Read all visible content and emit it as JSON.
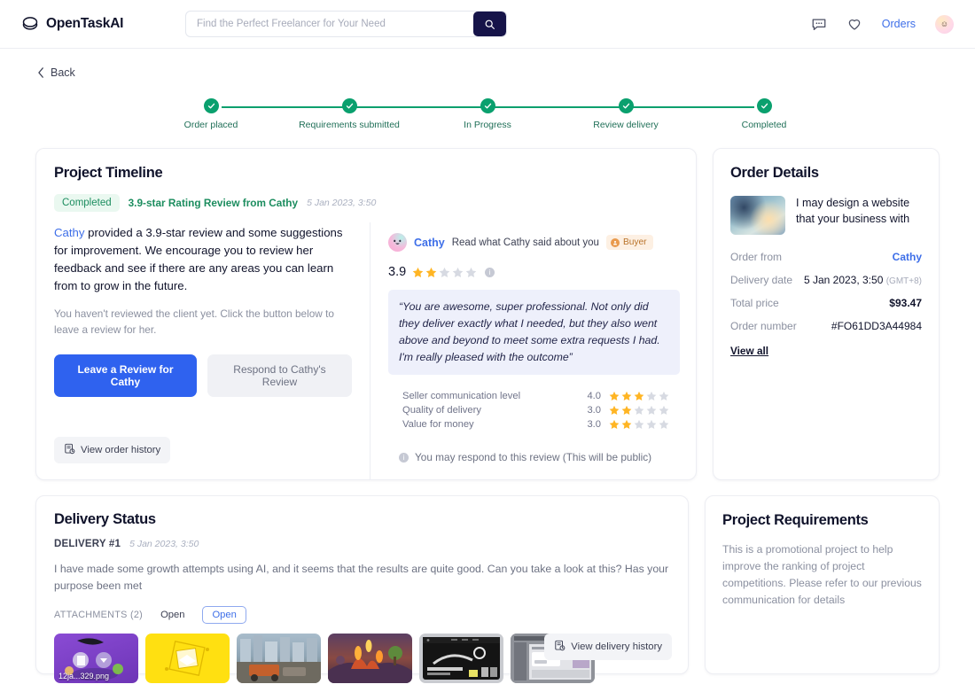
{
  "header": {
    "brand": "OpenTaskAI",
    "search_placeholder": "Find the Perfect Freelancer for Your Need",
    "search_value": "",
    "orders_label": "Orders",
    "accent_blue": "#3d6ee8",
    "search_button_bg": "#161449"
  },
  "nav": {
    "back_label": "Back"
  },
  "stepper": {
    "color": "#0aa06e",
    "steps": [
      {
        "label": "Order placed",
        "state": "done"
      },
      {
        "label": "Requirements submitted",
        "state": "done"
      },
      {
        "label": "In Progress",
        "state": "done"
      },
      {
        "label": "Review delivery",
        "state": "done"
      },
      {
        "label": "Completed",
        "state": "done"
      }
    ]
  },
  "timeline": {
    "title": "Project Timeline",
    "status_pill": "Completed",
    "entry_title": "3.9-star Rating Review from Cathy",
    "entry_date": "5 Jan 2023, 3:50",
    "paragraph_name": "Cathy",
    "paragraph_rest": " provided a 3.9-star review and some suggestions for improvement.  We encourage you to review her feedback and see if there are any areas you can learn from to grow in the future.",
    "subtext": "You haven't reviewed the client yet. Click the button below to leave a review for her.",
    "primary_button": "Leave a Review for Cathy",
    "secondary_button": "Respond to Cathy's Review",
    "history_button": "View order history"
  },
  "review": {
    "reviewer": "Cathy",
    "headline": "Read what Cathy said about you",
    "role_badge": "Buyer",
    "score": "3.9",
    "filled_stars": 2,
    "total_stars": 5,
    "quote": "“You are awesome, super professional. Not only did they deliver exactly what I needed, but they also went above and beyond to meet some extra requests I had. I'm really pleased with the outcome”",
    "subratings": [
      {
        "label": "Seller communication level",
        "value": "4.0",
        "filled": 3
      },
      {
        "label": "Quality of delivery",
        "value": "3.0",
        "filled": 2
      },
      {
        "label": "Value for money",
        "value": "3.0",
        "filled": 2
      }
    ],
    "respond_note": "You may respond to this review (This will be public)",
    "star_color": "#ffb524",
    "star_empty_color": "#d7dae2"
  },
  "order_details": {
    "title": "Order Details",
    "product_name": "I may design a website that your business with",
    "rows": [
      {
        "key": "Order from",
        "value": "Cathy",
        "style": "link"
      },
      {
        "key": "Delivery date",
        "value": "5 Jan 2023, 3:50",
        "suffix": "(GMT+8)",
        "style": "plain"
      },
      {
        "key": "Total price",
        "value": "$93.47",
        "style": "bold"
      },
      {
        "key": "Order number",
        "value": "#FO61DD3A44984",
        "style": "plain"
      }
    ],
    "view_all": "View all"
  },
  "delivery": {
    "title": "Delivery Status",
    "delivery_no": "DELIVERY #1",
    "date": "5 Jan 2023, 3:50",
    "message": "I have made some growth attempts using AI, and it seems that the results are quite good. Can you take a look at this? Has your purpose been met",
    "attachments_label": "ATTACHMENTS (2)",
    "open_buttons": [
      {
        "label": "Open",
        "active": false
      },
      {
        "label": "Open",
        "active": true
      }
    ],
    "thumbnails": [
      {
        "filename": "12ja...329.png"
      },
      {
        "filename": ""
      },
      {
        "filename": ""
      },
      {
        "filename": ""
      },
      {
        "filename": ""
      },
      {
        "filename": ""
      }
    ],
    "history_button": "View delivery history"
  },
  "requirements": {
    "title": "Project Requirements",
    "text": "This is a promotional project to help improve the ranking of project competitions. Please refer to our previous communication for details"
  }
}
